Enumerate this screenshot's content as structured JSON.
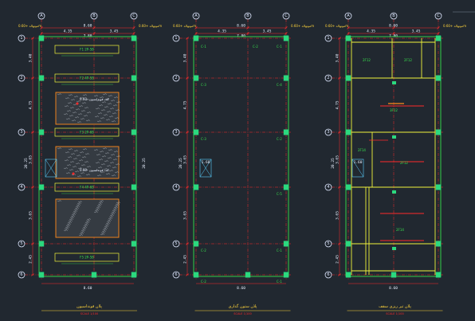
{
  "drawing": {
    "background": "#212830",
    "colors": {
      "grid_line": "#ff2a2a",
      "wall": "#37e04c",
      "beam": "#f1f33b",
      "column": "#2bd97f",
      "hatch": "#c9d0d8",
      "text": "#e9f0ff",
      "bubble": "#dfe8ff",
      "title": "#ffd43b"
    },
    "axes_x": [
      "A",
      "B",
      "C"
    ],
    "axes_y": [
      "1",
      "2",
      "3",
      "4",
      "5",
      "6"
    ],
    "dims_top": [
      "4.35",
      "3.45",
      "7.80"
    ],
    "dims_top_overall": "8.60",
    "dims_left": [
      "3.40",
      "4.75",
      "3.65",
      "3.40",
      "3.65",
      "2.45",
      "20.25"
    ],
    "dims_bottom": "8.60",
    "elev_label_left": "مونهالد +0.60m",
    "elev_label_right": "مونهالد +0.60m",
    "plans": [
      {
        "title": "پلان فونداسیون",
        "sub": "SCALE 1/100",
        "footing_labels": [
          "F1 2P-5B",
          "F2 4P-5B",
          "F3 2P-6B",
          "F4 4P-6B",
          "F5 2P-5B"
        ],
        "callouts": [
          "کف فونداسیون -0.60",
          "کف فونداسیون -0.60"
        ]
      },
      {
        "title": "پلان ستون گذاری",
        "sub": "SCALE 1/100",
        "column_labels": [
          "C-1",
          "C-2",
          "C-1",
          "C-3",
          "C-4",
          "C-3",
          "C-2",
          "C-5",
          "C-2",
          "C-1",
          "C-2",
          "C-1"
        ],
        "mid_dim": "1.60"
      },
      {
        "title": "پلان تیر ریزی سقف",
        "sub": "SCALE 1/100",
        "beam_labels": [
          "2F12",
          "2F12",
          "3F12",
          "2F14",
          "2F12",
          "2F14"
        ],
        "mid_dim": "1.60"
      }
    ]
  }
}
